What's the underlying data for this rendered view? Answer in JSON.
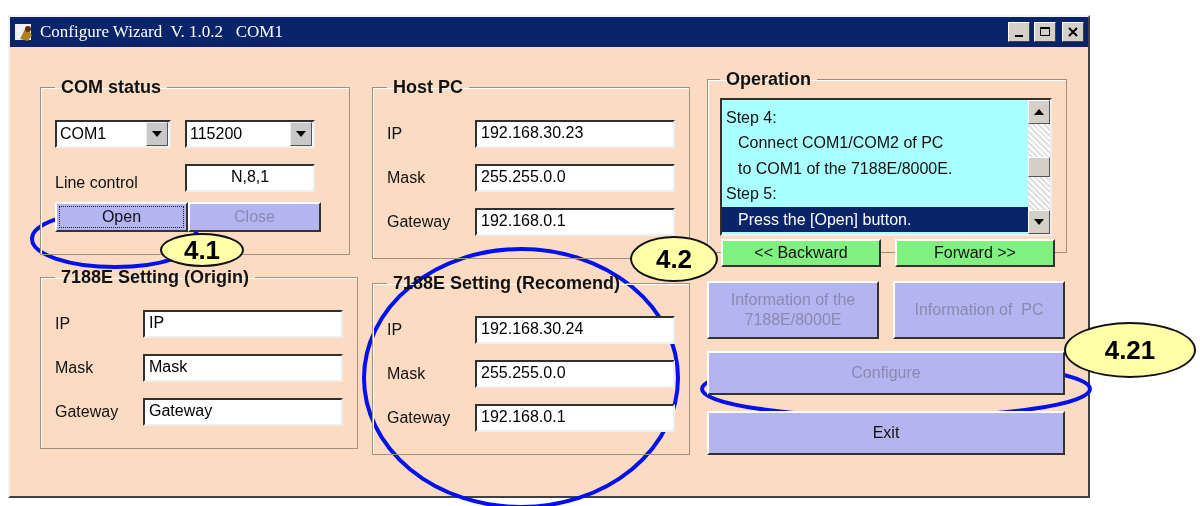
{
  "window": {
    "title": "Configure Wizard  V. 1.0.2   COM1"
  },
  "com_status": {
    "title": "COM status",
    "port": "COM1",
    "baud": "115200",
    "line_control_label": "Line control",
    "line_control": "N,8,1",
    "buttons": [
      {
        "label": "Open",
        "disabled": false,
        "focused": true
      },
      {
        "label": "Close",
        "disabled": true,
        "focused": false
      }
    ]
  },
  "origin": {
    "title": "7188E Setting (Origin)",
    "fields": [
      {
        "label": "IP",
        "value": "IP"
      },
      {
        "label": "Mask",
        "value": "Mask"
      },
      {
        "label": "Gateway",
        "value": "Gateway"
      }
    ]
  },
  "host_pc": {
    "title": "Host PC",
    "fields": [
      {
        "label": "IP",
        "value": "192.168.30.23"
      },
      {
        "label": "Mask",
        "value": "255.255.0.0"
      },
      {
        "label": "Gateway",
        "value": "192.168.0.1"
      }
    ]
  },
  "recommend": {
    "title": "7188E Setting (Recomend)",
    "fields": [
      {
        "label": "IP",
        "value": "192.168.30.24"
      },
      {
        "label": "Mask",
        "value": "255.255.0.0"
      },
      {
        "label": "Gateway",
        "value": "192.168.0.1"
      }
    ]
  },
  "operation": {
    "title": "Operation",
    "steps": [
      {
        "kind": "heading",
        "text": "Step 4:",
        "selected": false
      },
      {
        "kind": "detail",
        "text": "Connect COM1/COM2 of PC",
        "selected": false
      },
      {
        "kind": "detail",
        "text": "to COM1 of the 7188E/8000E.",
        "selected": false
      },
      {
        "kind": "heading",
        "text": "Step 5:",
        "selected": false
      },
      {
        "kind": "detail",
        "text": "Press the [Open] button.",
        "selected": true
      }
    ],
    "nav_buttons": [
      {
        "label": "<< Backward",
        "disabled": false
      },
      {
        "label": "Forward >>",
        "disabled": false
      }
    ],
    "info_buttons": [
      {
        "label": "Information of the 7188E/8000E",
        "disabled": true
      },
      {
        "label": "Information of  PC",
        "disabled": true
      }
    ],
    "configure": {
      "label": "Configure",
      "disabled": true
    },
    "exit": {
      "label": "Exit",
      "disabled": false
    }
  },
  "callouts": [
    {
      "label": "4.1"
    },
    {
      "label": "4.2"
    },
    {
      "label": "4.21"
    }
  ]
}
